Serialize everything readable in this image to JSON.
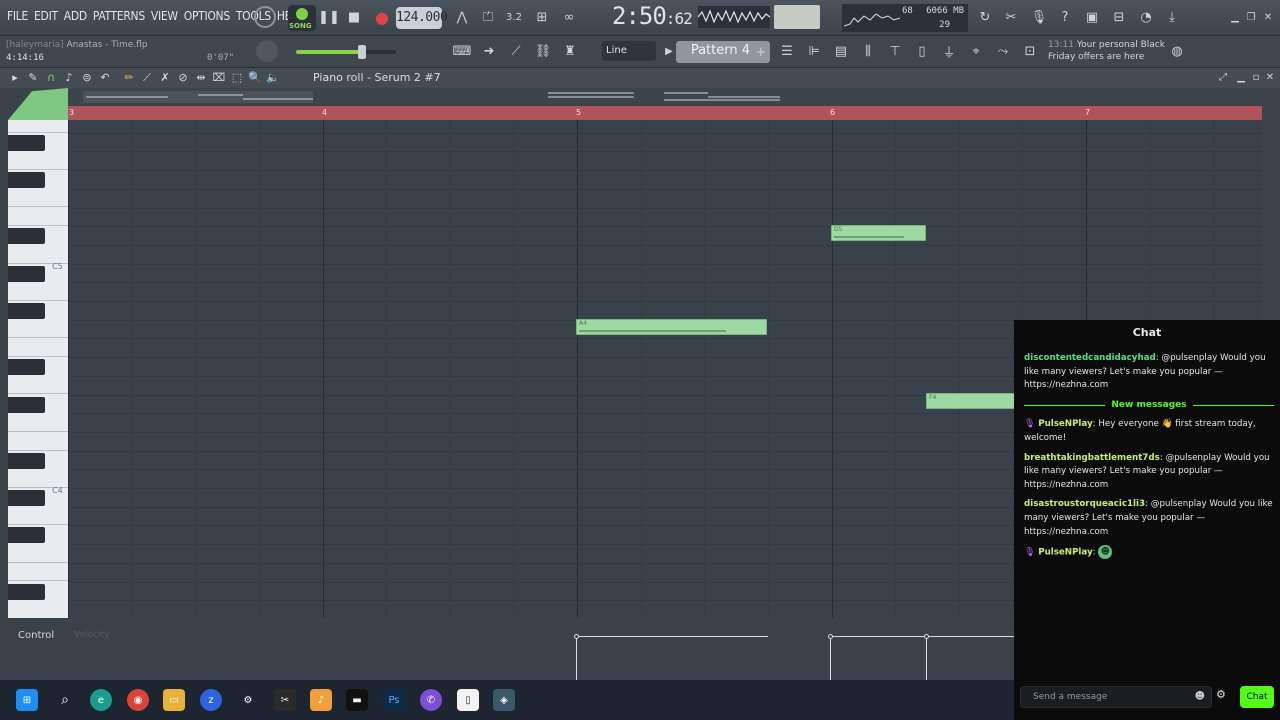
{
  "menu": [
    "FILE",
    "EDIT",
    "ADD",
    "PATTERNS",
    "VIEW",
    "OPTIONS",
    "TOOLS",
    "HELP"
  ],
  "transport": {
    "song_label": "SONG",
    "tempo": "124.000",
    "time_main": "2:50",
    "time_sub": "62",
    "cpu": "68",
    "memory": "6066 MB",
    "polyphony": "29"
  },
  "project": {
    "filename_owner": "[haleymaria]",
    "filename": "Anastas - Time.flp",
    "position": "4:14:16",
    "position_right": "0'07\""
  },
  "toolbar2": {
    "snap": "Line",
    "pattern": "Pattern 4",
    "news_time": "13:11",
    "news_text": "Your personal Black Friday offers are here"
  },
  "piano_roll": {
    "title": "Piano roll - Serum 2 #7",
    "ruler_ticks": [
      "3",
      "4",
      "5",
      "6",
      "7"
    ],
    "key_labels": [
      "C5",
      "C4"
    ],
    "notes": [
      {
        "label": "D5"
      },
      {
        "label": "A4"
      },
      {
        "label": "F4"
      }
    ]
  },
  "control": {
    "label": "Control",
    "sublabel": "Velocity"
  },
  "chat": {
    "title": "Chat",
    "divider": "New messages",
    "messages": [
      {
        "user": "discontentedcandidacyhad",
        "text": ": @pulsenplay Would you like many viewers? Let's make you popular — https://nezhna.com"
      },
      {
        "user": "PulseNPlay",
        "text": ": Hey everyone 👋 first stream today, welcome!"
      },
      {
        "user": "breathtakingbattlement7ds",
        "text": ": @pulsenplay Would you like many viewers? Let's make you popular — https://nezhna.com"
      },
      {
        "user": "disastroustorqueacic1li3",
        "text": ": @pulsenplay Would you like many viewers? Let's make you popular — https://nezhna.com"
      },
      {
        "user": "PulseNPlay",
        "text": ":"
      }
    ],
    "input_placeholder": "Send a message",
    "send_label": "Chat"
  },
  "colors": {
    "accent_green": "#53fc18",
    "note_green": "#9fd8a3",
    "ruler_red": "#b0545c"
  }
}
